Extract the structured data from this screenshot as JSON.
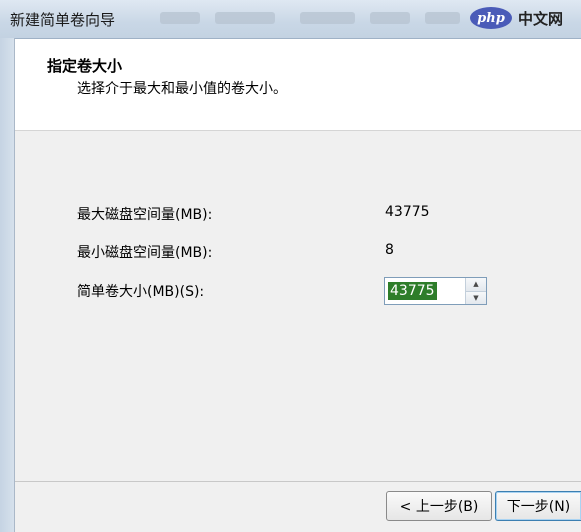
{
  "window": {
    "title": "新建简单卷向导"
  },
  "watermark": {
    "logo_text": "php",
    "site_text": "中文网"
  },
  "header": {
    "title": "指定卷大小",
    "subtitle": "选择介于最大和最小值的卷大小。"
  },
  "fields": [
    {
      "label": "最大磁盘空间量(MB):",
      "value": "43775"
    },
    {
      "label": "最小磁盘空间量(MB):",
      "value": "8"
    },
    {
      "label": "简单卷大小(MB)(S):",
      "value": "43775"
    }
  ],
  "buttons": {
    "back": "< 上一步(B)",
    "next": "下一步(N)"
  },
  "colors": {
    "selection_bg": "#2e7d2a",
    "header_bg": "#ffffff",
    "dialog_bg": "#f0f0f0"
  }
}
